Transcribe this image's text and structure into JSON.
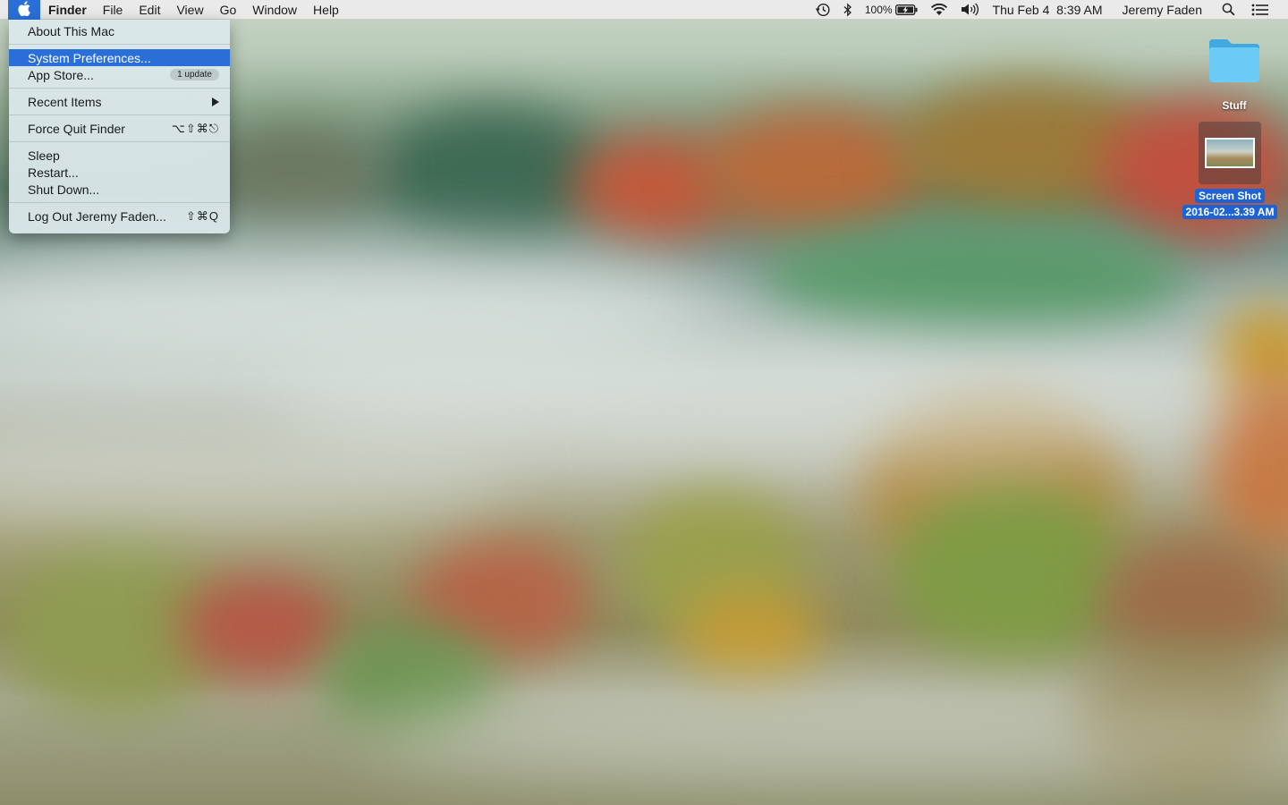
{
  "menubar": {
    "app_name": "Finder",
    "menus": [
      "File",
      "Edit",
      "View",
      "Go",
      "Window",
      "Help"
    ],
    "status": {
      "time_machine_icon": "time-machine-icon",
      "bluetooth_icon": "bluetooth-icon",
      "battery_percent": "100%",
      "battery_icon": "battery-charging-icon",
      "wifi_icon": "wifi-icon",
      "volume_icon": "volume-icon",
      "datetime": "Thu Feb 4  8:39 AM",
      "user": "Jeremy Faden",
      "spotlight_icon": "search-icon",
      "notification_icon": "list-icon"
    }
  },
  "apple_menu": {
    "items": {
      "about": "About This Mac",
      "system_prefs": "System Preferences...",
      "app_store": "App Store...",
      "app_store_badge": "1 update",
      "recent": "Recent Items",
      "force_quit": "Force Quit Finder",
      "force_quit_shortcut": "⌥⇧⌘⎋",
      "sleep": "Sleep",
      "restart": "Restart...",
      "shutdown": "Shut Down...",
      "logout": "Log Out Jeremy Faden...",
      "logout_shortcut": "⇧⌘Q"
    },
    "highlighted": "System Preferences..."
  },
  "desktop": {
    "icons": [
      {
        "label": "Stuff",
        "kind": "folder"
      },
      {
        "label_line1": "Screen Shot",
        "label_line2": "2016-02...3.39 AM",
        "kind": "screenshot",
        "selected": true
      }
    ]
  },
  "colors": {
    "accent": "#2a6fd8",
    "folder": "#5cc3f2"
  }
}
